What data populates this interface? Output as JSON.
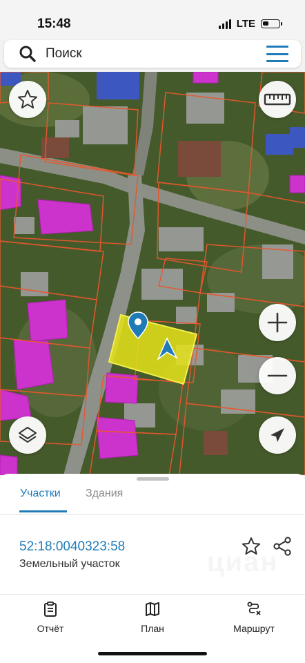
{
  "status_bar": {
    "time": "15:48",
    "network": "LTE"
  },
  "search": {
    "placeholder": "Поиск"
  },
  "map": {
    "icons": {
      "favorite": "star-icon",
      "measure": "ruler-icon",
      "layers": "layers-icon",
      "zoom_in": "plus-icon",
      "zoom_out": "minus-icon",
      "locate": "navigation-arrow-icon"
    },
    "colors": {
      "selected_parcel": "#e5e21a",
      "building": "#cc33cc",
      "parcel_border": "#e8572e"
    }
  },
  "sheet": {
    "tabs": [
      {
        "label": "Участки",
        "active": true
      },
      {
        "label": "Здания",
        "active": false
      }
    ],
    "parcel": {
      "cadastral_number": "52:18:0040323:58",
      "type": "Земельный участок"
    },
    "watermark": "циан"
  },
  "bottom_nav": [
    {
      "label": "Отчёт",
      "icon": "report-icon"
    },
    {
      "label": "План",
      "icon": "map-plan-icon"
    },
    {
      "label": "Маршрут",
      "icon": "route-icon"
    }
  ],
  "accent_color": "#1f7bb8"
}
